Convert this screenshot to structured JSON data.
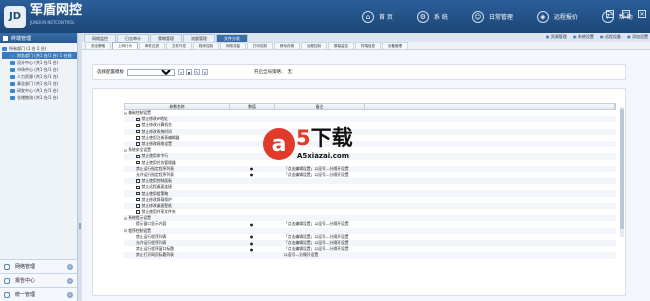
{
  "app": {
    "logo_badge": "JD",
    "title": "军盾网控",
    "subtitle": "JUNDUN NETCONTROL"
  },
  "topnav": [
    {
      "label": "首 页",
      "icon": "home-icon"
    },
    {
      "label": "系 统",
      "icon": "gear-icon"
    },
    {
      "label": "日常管理",
      "icon": "user-icon"
    },
    {
      "label": "远程报价",
      "icon": "tag-icon"
    },
    {
      "label": "帮 助",
      "icon": "help-icon"
    }
  ],
  "sidebar": {
    "title": "终端管理",
    "tree": [
      {
        "label": "所有部门 (1 台 2 台)",
        "indent": 0,
        "selected": false
      },
      {
        "label": "财务部门 (共1 台/1 台) 1 在线",
        "indent": 8,
        "selected": true
      },
      {
        "label": "设计中心 (共1 台/1 台)",
        "indent": 8,
        "selected": false
      },
      {
        "label": "市场中心 (共1 台/1 台)",
        "indent": 8,
        "selected": false
      },
      {
        "label": "人力资源 (共1 台/1 台)",
        "indent": 8,
        "selected": false
      },
      {
        "label": "事业部门 (共1 台/1 台)",
        "indent": 8,
        "selected": false
      },
      {
        "label": "研发中心 (共1 台/1 台)",
        "indent": 8,
        "selected": false
      },
      {
        "label": "仓储物流 (共1 台/1 台)",
        "indent": 8,
        "selected": false
      }
    ],
    "bottom_nav": [
      "网络管理",
      "报告中心",
      "统一管理"
    ]
  },
  "tabs_primary": [
    "网络监控",
    "日志审计",
    "策略管理",
    "流量管理",
    "文件分发"
  ],
  "tabs_primary_active": 4,
  "right_tools": [
    "资源管理",
    "系统设置",
    "远程设备",
    "添加设置"
  ],
  "tabs_secondary": [
    "安全策略",
    "上网行为",
    "邮件过滤",
    "文件外发",
    "程序控制",
    "网络流量",
    "打印控制",
    "移动存储",
    "远程控制",
    "屏幕监控",
    "终端信息",
    "设备管理"
  ],
  "tabs_secondary_active": 1,
  "toolbar": {
    "label": "选择配置模板",
    "select_value": "",
    "switch_label": "开启全局策略：",
    "switch_value": "无"
  },
  "grid": {
    "headers": [
      "参数名称",
      "数值",
      "备注"
    ],
    "rows": [
      {
        "name": "基础控制设置",
        "type": "group",
        "value": "",
        "note": ""
      },
      {
        "name": "禁止修改IP地址",
        "type": "check",
        "value": "",
        "note": ""
      },
      {
        "name": "禁止修改计算机名",
        "type": "check",
        "value": "",
        "note": ""
      },
      {
        "name": "禁止修改系统时间",
        "type": "check",
        "value": "",
        "note": ""
      },
      {
        "name": "禁止使用注册表编辑器",
        "type": "check",
        "value": "",
        "note": ""
      },
      {
        "name": "禁止修改网络设置",
        "type": "check",
        "value": "",
        "note": ""
      },
      {
        "name": "系统安全设置",
        "type": "group",
        "value": "",
        "note": ""
      },
      {
        "name": "禁止使用命令行",
        "type": "check",
        "value": "",
        "note": ""
      },
      {
        "name": "禁止使用任务管理器",
        "type": "check",
        "value": "",
        "note": ""
      },
      {
        "name": "禁止运行指定程序列表",
        "type": "sub",
        "value": "●",
        "note": "「点击编辑设置」以逗号—分隔开设置"
      },
      {
        "name": "允许运行指定程序列表",
        "type": "sub",
        "value": "●",
        "note": "「点击编辑设置」以逗号—分隔开设置"
      },
      {
        "name": "禁止使用控制面板",
        "type": "check",
        "value": "",
        "note": ""
      },
      {
        "name": "禁止远程桌面连接",
        "type": "check",
        "value": "",
        "note": ""
      },
      {
        "name": "禁止使用组策略",
        "type": "check",
        "value": "",
        "note": ""
      },
      {
        "name": "禁止修改屏幕保护",
        "type": "check",
        "value": "",
        "note": ""
      },
      {
        "name": "禁止修改桌面壁纸",
        "type": "check",
        "value": "",
        "note": ""
      },
      {
        "name": "禁止使用共享文件夹",
        "type": "check",
        "value": "",
        "note": ""
      },
      {
        "name": "系统提示设置",
        "type": "group",
        "value": "",
        "note": ""
      },
      {
        "name": "提示窗口显示内容",
        "type": "sub",
        "value": "●",
        "note": "「点击编辑设置」以逗号—分隔开设置"
      },
      {
        "name": "程序控制设置",
        "type": "group",
        "value": "",
        "note": ""
      },
      {
        "name": "禁止运行程序列表",
        "type": "sub",
        "value": "●",
        "note": "「点击编辑设置」以逗号—分隔开设置"
      },
      {
        "name": "允许运行程序列表",
        "type": "sub",
        "value": "●",
        "note": "「点击编辑设置」以逗号—分隔开设置"
      },
      {
        "name": "禁止运行程序窗口标题",
        "type": "sub",
        "value": "●",
        "note": "「点击编辑设置」以逗号—分隔开设置"
      },
      {
        "name": "禁止打开网页标题列表",
        "type": "sub",
        "value": "",
        "note": "以逗号—分隔开设置"
      }
    ]
  },
  "watermark": {
    "circle": "a",
    "five": "5",
    "big": "下载",
    "small": "A5xiazai.com"
  },
  "window_controls": [
    "—",
    "□",
    "✕"
  ]
}
